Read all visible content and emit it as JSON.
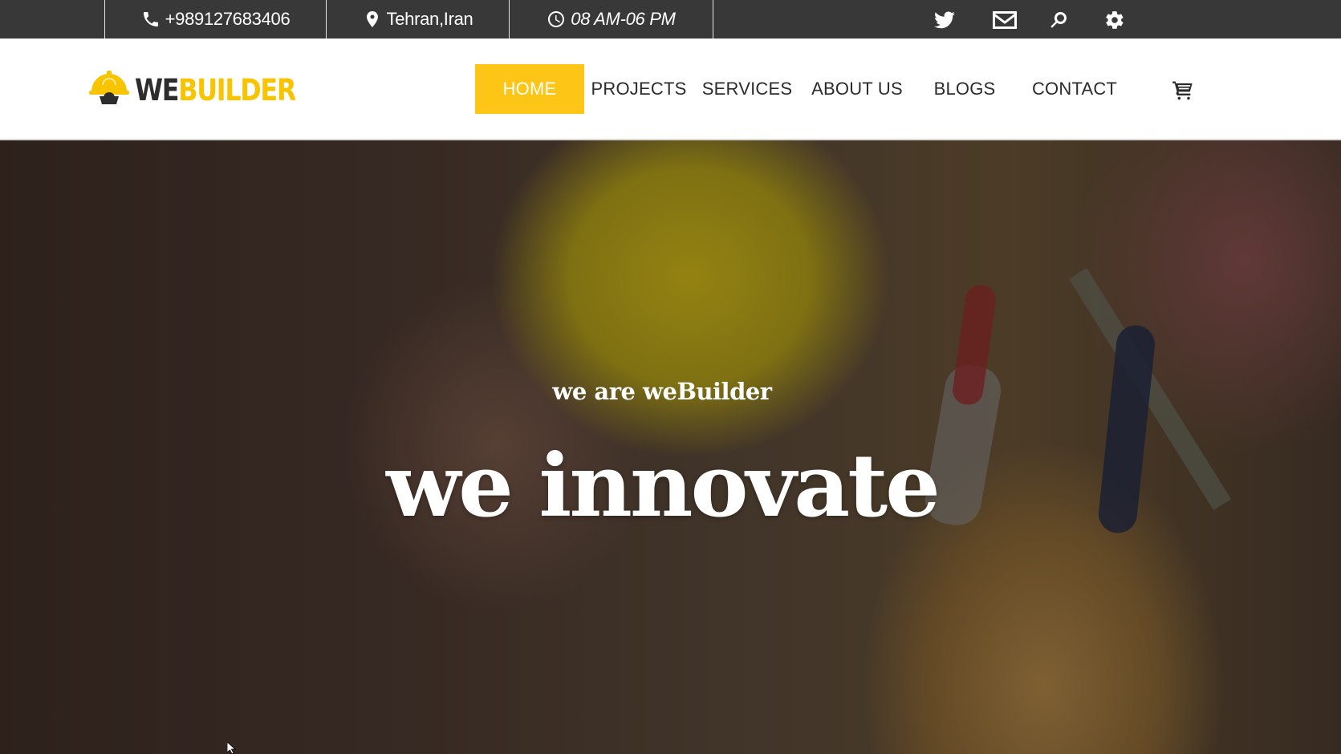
{
  "topbar": {
    "phone": "+989127683406",
    "location": "Tehran,Iran",
    "hours": "08 AM-06 PM",
    "icons": [
      "phone-icon",
      "map-pin-icon",
      "clock-icon",
      "twitter-icon",
      "mail-icon",
      "search-icon",
      "gear-icon"
    ]
  },
  "logo": {
    "we": "WE",
    "builder": "BUILDER"
  },
  "nav": {
    "items": [
      "HOME",
      "PROJECTS",
      "SERVICES",
      "ABOUT US",
      "BLOGS",
      "CONTACT"
    ],
    "active": "HOME"
  },
  "hero": {
    "subtitle": "we are weBuilder",
    "title": "we innovate"
  },
  "colors": {
    "accent": "#FDC515",
    "topbar_bg": "#383838",
    "text_dark": "#2B2B2B"
  }
}
